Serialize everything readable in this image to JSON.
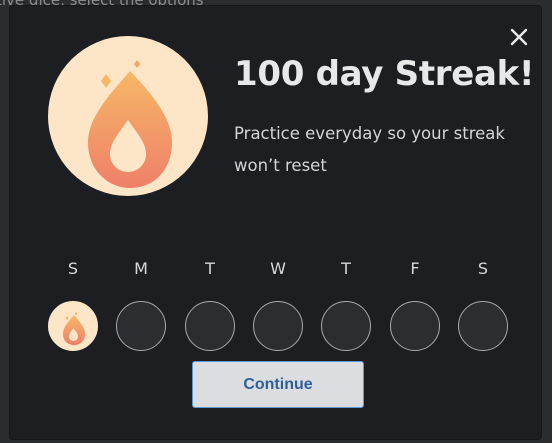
{
  "background": {
    "partial_text": "tive dice, select the options"
  },
  "modal": {
    "title": "100 day Streak!",
    "subtitle": "Practice everyday so your streak won’t reset",
    "hero_icon": "flame-icon",
    "close_icon": "close-icon",
    "days": [
      {
        "letter": "S",
        "completed": true
      },
      {
        "letter": "M",
        "completed": false
      },
      {
        "letter": "T",
        "completed": false
      },
      {
        "letter": "W",
        "completed": false
      },
      {
        "letter": "T",
        "completed": false
      },
      {
        "letter": "F",
        "completed": false
      },
      {
        "letter": "S",
        "completed": false
      }
    ],
    "continue_label": "Continue"
  },
  "colors": {
    "modal_bg": "#1c1e22",
    "hero_bg": "#fde5c8",
    "flame_top": "#f6b866",
    "flame_bottom": "#ef7f6a",
    "button_text": "#2f5f97",
    "button_border": "#5b9bd5"
  }
}
